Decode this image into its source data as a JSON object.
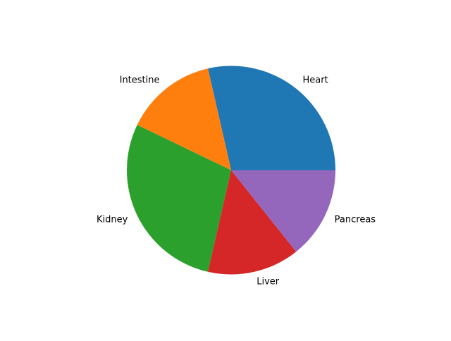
{
  "chart_data": {
    "type": "pie",
    "labels": [
      "Heart",
      "Intestine",
      "Kidney",
      "Liver",
      "Pancreas"
    ],
    "values": [
      2,
      1,
      2,
      1,
      1
    ],
    "colors": [
      "#1f77b4",
      "#ff7f0e",
      "#2ca02c",
      "#d62728",
      "#9467bd"
    ],
    "start_angle_deg": 0,
    "direction": "counterclockwise",
    "title": ""
  }
}
